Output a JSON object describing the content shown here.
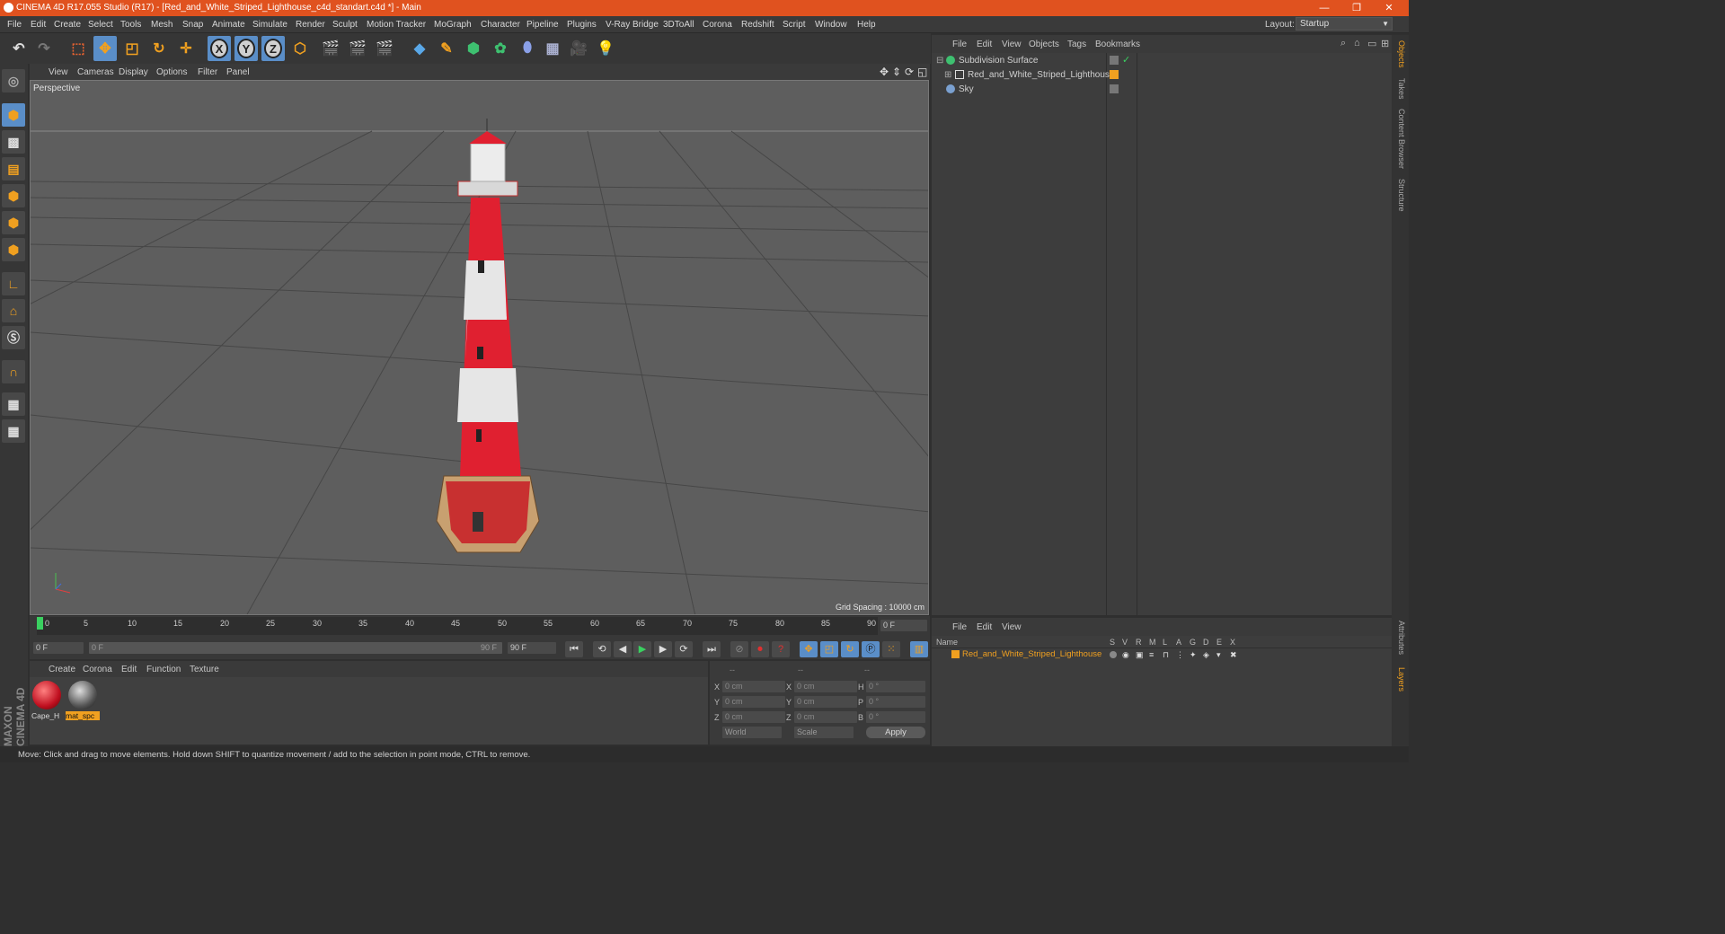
{
  "window": {
    "title": "CINEMA 4D R17.055 Studio (R17) - [Red_and_White_Striped_Lighthouse_c4d_standart.c4d *] - Main",
    "minimize": "—",
    "maximize": "❐",
    "close": "✕"
  },
  "menubar": {
    "items": [
      "File",
      "Edit",
      "Create",
      "Select",
      "Tools",
      "Mesh",
      "Snap",
      "Animate",
      "Simulate",
      "Render",
      "Sculpt",
      "Motion Tracker",
      "MoGraph",
      "Character",
      "Pipeline",
      "Plugins",
      "V-Ray Bridge",
      "3DToAll",
      "Corona",
      "Redshift",
      "Script",
      "Window",
      "Help"
    ],
    "layout_label": "Layout:",
    "layout_value": "Startup"
  },
  "toolbar": {
    "axis_x": "X",
    "axis_y": "Y",
    "axis_z": "Z"
  },
  "viewport": {
    "menu": [
      "View",
      "Cameras",
      "Display",
      "Options",
      "Filter",
      "Panel"
    ],
    "label": "Perspective",
    "grid_spacing": "Grid Spacing : 10000 cm"
  },
  "timeline": {
    "ticks": [
      "0",
      "5",
      "10",
      "15",
      "20",
      "25",
      "30",
      "35",
      "40",
      "45",
      "50",
      "55",
      "60",
      "65",
      "70",
      "75",
      "80",
      "85",
      "90"
    ],
    "current_frame": "0 F"
  },
  "transport": {
    "start_field": "0 F",
    "range_start": "0 F",
    "range_end": "90 F",
    "end_field": "90 F"
  },
  "material_manager": {
    "menu": [
      "Create",
      "Corona",
      "Edit",
      "Function",
      "Texture"
    ],
    "materials": [
      {
        "name": "Cape_H",
        "selected": false
      },
      {
        "name": "mat_spc",
        "selected": true
      }
    ]
  },
  "coordinates": {
    "headers": [
      "--",
      "--",
      "--"
    ],
    "rows": [
      {
        "axis": "X",
        "pos": "0 cm",
        "axis2": "X",
        "size": "0 cm",
        "rot_axis": "H",
        "rot": "0 °"
      },
      {
        "axis": "Y",
        "pos": "0 cm",
        "axis2": "Y",
        "size": "0 cm",
        "rot_axis": "P",
        "rot": "0 °"
      },
      {
        "axis": "Z",
        "pos": "0 cm",
        "axis2": "Z",
        "size": "0 cm",
        "rot_axis": "B",
        "rot": "0 °"
      }
    ],
    "mode1": "World",
    "mode2": "Scale",
    "apply": "Apply"
  },
  "object_manager": {
    "menu": [
      "File",
      "Edit",
      "View",
      "Objects",
      "Tags",
      "Bookmarks"
    ],
    "objects": [
      {
        "name": "Subdivision Surface",
        "indent": 0
      },
      {
        "name": "Red_and_White_Striped_Lighthouse",
        "indent": 1
      },
      {
        "name": "Sky",
        "indent": 0
      }
    ]
  },
  "layer_manager": {
    "menu": [
      "File",
      "Edit",
      "View"
    ],
    "columns": [
      "Name",
      "S",
      "V",
      "R",
      "M",
      "L",
      "A",
      "G",
      "D",
      "E",
      "X"
    ],
    "layers": [
      {
        "name": "Red_and_White_Striped_Lighthouse"
      }
    ]
  },
  "side_tabs": [
    "Objects",
    "Takes",
    "Content Browser",
    "Structure",
    "Attributes",
    "Layers"
  ],
  "status": "Move: Click and drag to move elements. Hold down SHIFT to quantize movement / add to the selection in point mode, CTRL to remove.",
  "branding": "MAXON CINEMA 4D",
  "colors": {
    "accent": "#e0521f",
    "selection": "#5a8ec8",
    "highlight": "#f0a020"
  }
}
